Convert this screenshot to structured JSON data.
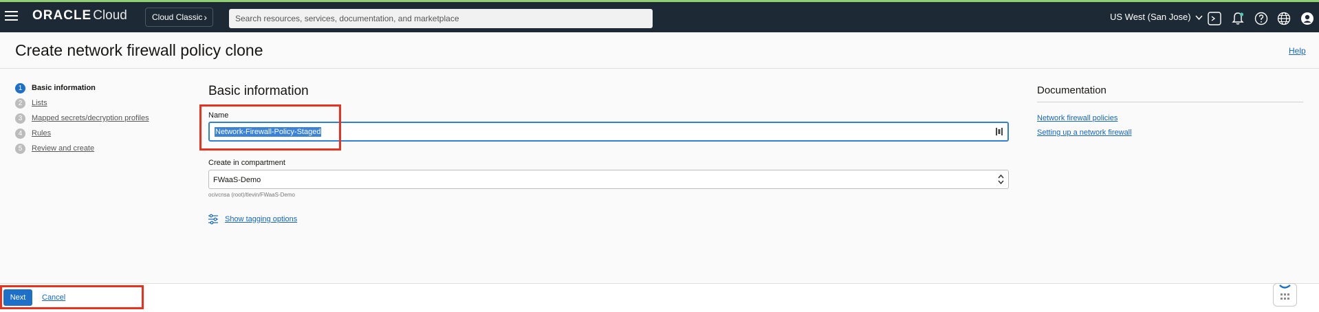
{
  "topbar": {
    "logo_brand": "ORACLE",
    "logo_product": "Cloud",
    "classic_label": "Cloud Classic",
    "search_placeholder": "Search resources, services, documentation, and marketplace",
    "region": "US West (San Jose)",
    "icons": [
      "menu-icon",
      "cloud-shell-icon",
      "notifications-icon",
      "help-icon",
      "language-icon",
      "profile-icon"
    ]
  },
  "page": {
    "title": "Create network firewall policy clone",
    "help_link": "Help"
  },
  "steps": [
    {
      "num": "1",
      "label": "Basic information",
      "active": true
    },
    {
      "num": "2",
      "label": "Lists",
      "active": false
    },
    {
      "num": "3",
      "label": "Mapped secrets/decryption profiles",
      "active": false
    },
    {
      "num": "4",
      "label": "Rules",
      "active": false
    },
    {
      "num": "5",
      "label": "Review and create",
      "active": false
    }
  ],
  "form": {
    "section_title": "Basic information",
    "name_label": "Name",
    "name_value": "Network-Firewall-Policy-Staged",
    "compartment_label": "Create in compartment",
    "compartment_value": "FWaaS-Demo",
    "compartment_path": "ocivcnsa (root)/tlevin/FWaaS-Demo",
    "tagging_link": "Show tagging options"
  },
  "documentation": {
    "title": "Documentation",
    "links": [
      "Network firewall policies",
      "Setting up a network firewall"
    ]
  },
  "footer": {
    "next_label": "Next",
    "cancel_label": "Cancel"
  },
  "colors": {
    "topbar_bg": "#1d2a35",
    "primary": "#1e6fc8",
    "link": "#1565c0",
    "highlight": "#e8321e"
  }
}
